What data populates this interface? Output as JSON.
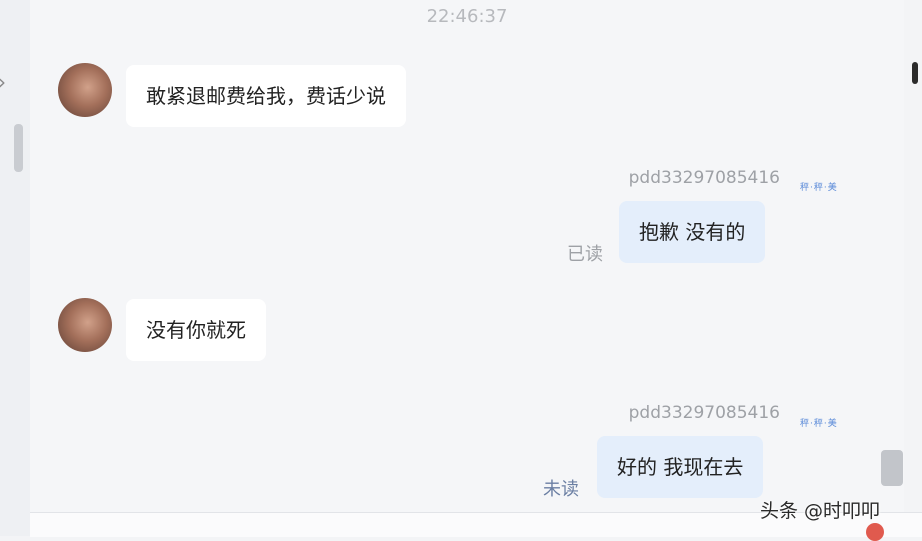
{
  "timestamp": "22:46:37",
  "messages": [
    {
      "direction": "in",
      "text": "敢紧退邮费给我，费话少说"
    },
    {
      "direction": "out",
      "sender": "pdd33297085416",
      "tag": "秤·秤·美",
      "text": "抱歉 没有的",
      "status": "已读"
    },
    {
      "direction": "in",
      "text": "没有你就死"
    },
    {
      "direction": "out",
      "sender": "pdd33297085416",
      "tag": "秤·秤·美",
      "text": "好的 我现在去",
      "status": "未读"
    }
  ],
  "icons": {
    "left_chevron": "chevron-right-icon",
    "avatar": "avatar-image"
  },
  "watermark": "头条 @时叩叩",
  "colors": {
    "outgoing_bubble": "#e4eefb",
    "incoming_bubble": "#ffffff",
    "unread_status": "#6b7fa3"
  }
}
